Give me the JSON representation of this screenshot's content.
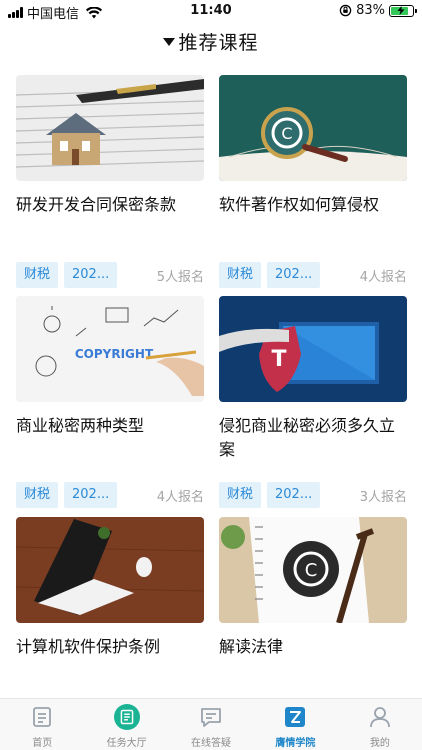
{
  "status_bar": {
    "carrier": "中国电信",
    "time": "11:40",
    "battery": "83%",
    "battery_level": 0.83
  },
  "header": {
    "title": "推荐课程"
  },
  "courses": [
    {
      "title": "研发开发合同保密条款",
      "tags": [],
      "enroll": ""
    },
    {
      "title": "软件著作权如何算侵权",
      "tags": [],
      "enroll": ""
    },
    {
      "title": "商业秘密两种类型",
      "tags": [
        "财税",
        "202..."
      ],
      "enroll": "5人报名"
    },
    {
      "title": "侵犯商业秘密必须多久立案",
      "tags": [
        "财税",
        "202..."
      ],
      "enroll": "4人报名"
    },
    {
      "title": "计算机软件保护条例",
      "tags": [
        "财税",
        "202..."
      ],
      "enroll": "4人报名"
    },
    {
      "title": "解读法律",
      "tags": [
        "财税",
        "202..."
      ],
      "enroll": "3人报名"
    }
  ],
  "tab_bar": {
    "items": [
      {
        "label": "首页",
        "icon": "home-doc-icon"
      },
      {
        "label": "任务大厅",
        "icon": "task-list-icon"
      },
      {
        "label": "在线答疑",
        "icon": "chat-icon"
      },
      {
        "label": "膺情学院",
        "icon": "academy-icon"
      },
      {
        "label": "我的",
        "icon": "profile-icon"
      }
    ],
    "active_index": 3
  },
  "colors": {
    "accent": "#1f87c9",
    "tag_bg": "#e3f1fb",
    "tag_text": "#2b8ad6",
    "task_green": "#1ab394",
    "battery_green": "#34c759"
  }
}
